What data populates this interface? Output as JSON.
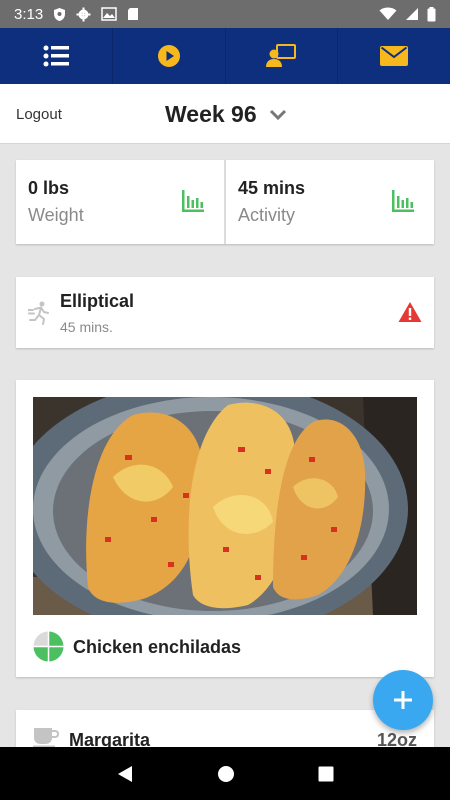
{
  "status_bar": {
    "time": "3:13"
  },
  "app_nav": {
    "tabs": [
      {
        "icon": "list-icon"
      },
      {
        "icon": "play-circle-icon"
      },
      {
        "icon": "coach-icon"
      },
      {
        "icon": "mail-icon"
      }
    ],
    "colors": {
      "background": "#0d2f7e",
      "icon": "#f6b81c"
    }
  },
  "header": {
    "logout_label": "Logout",
    "week_title": "Week 96"
  },
  "stats": {
    "weight": {
      "value": "0 lbs",
      "label": "Weight"
    },
    "activity": {
      "value": "45 mins",
      "label": "Activity"
    },
    "chart_icon_color": "#4cc061"
  },
  "exercise": {
    "name": "Elliptical",
    "duration": "45 mins.",
    "warning_color": "#e53935"
  },
  "meal": {
    "name": "Chicken enchiladas"
  },
  "drink": {
    "name": "Margarita",
    "amount": "12oz"
  },
  "fab": {
    "icon": "plus-icon",
    "color": "#3aa8f0"
  }
}
